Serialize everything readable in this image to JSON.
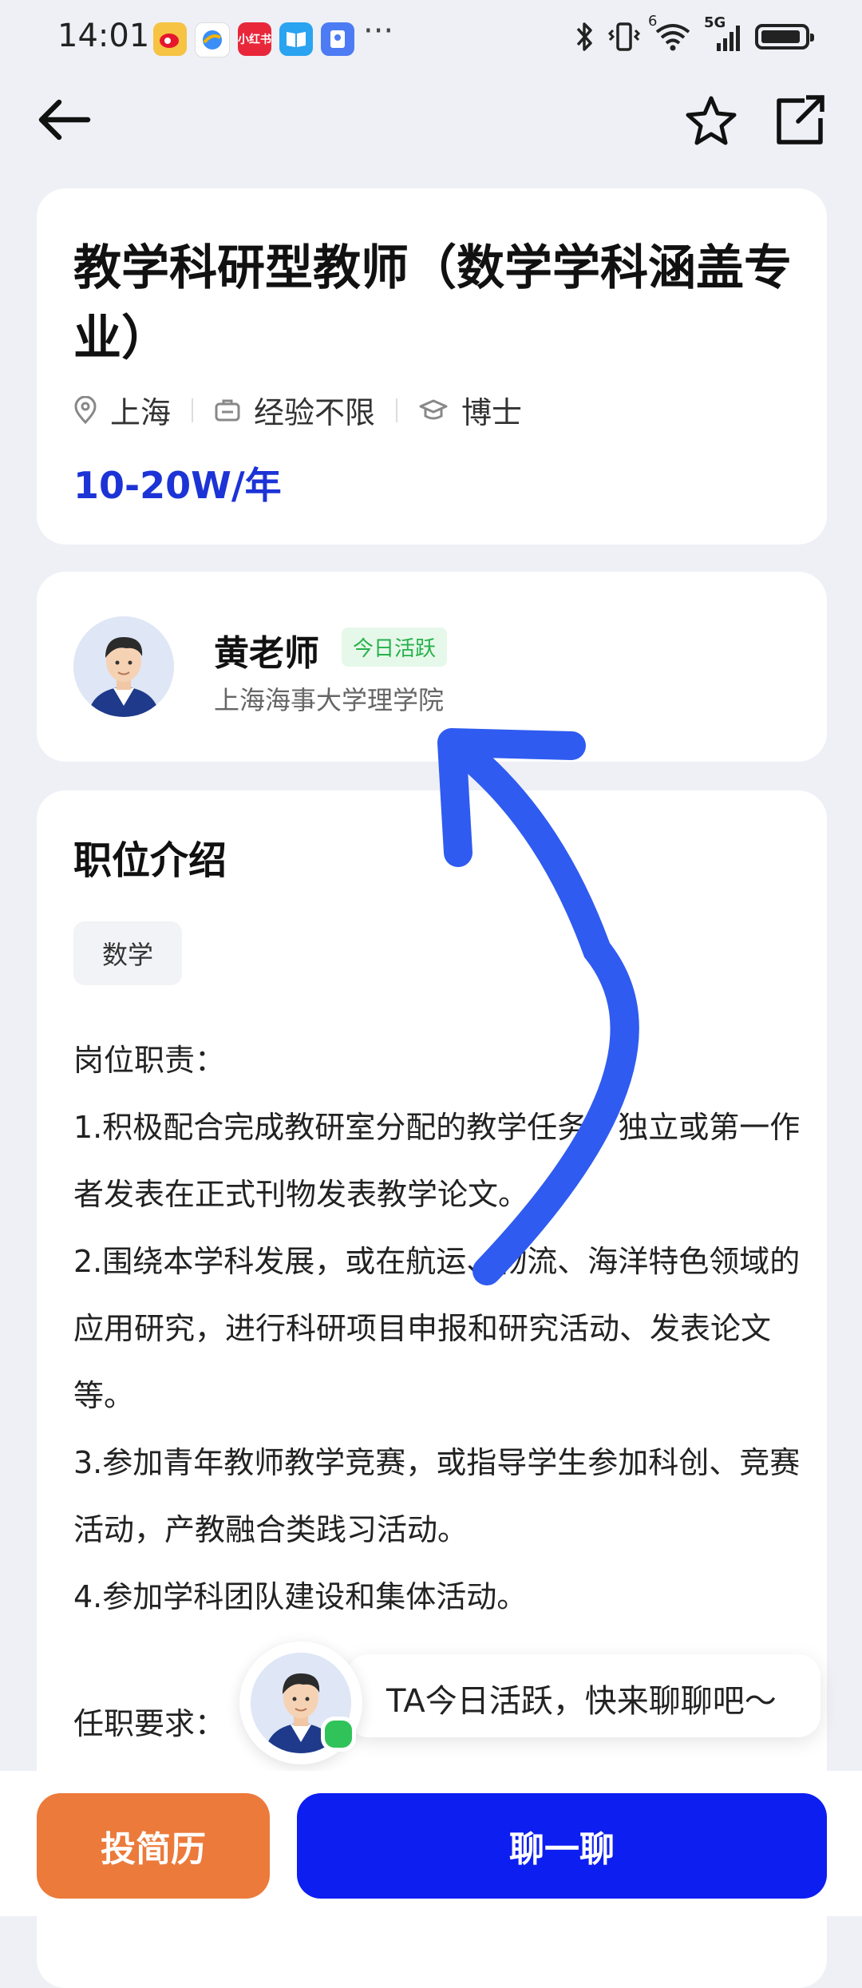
{
  "status_bar": {
    "time": "14:01",
    "app_icons": [
      "weibo-icon",
      "browser-icon",
      "xiaohongshu-icon",
      "book-icon",
      "tool-icon"
    ],
    "xiaohongshu_label": "小红书",
    "more": "···",
    "network": "5G",
    "wifi_badge": "6"
  },
  "job": {
    "title": "教学科研型教师（数学学科涵盖专业）",
    "location": "上海",
    "experience": "经验不限",
    "education": "博士",
    "salary": "10-20W/年"
  },
  "recruiter": {
    "name": "黄老师",
    "badge": "今日活跃",
    "org": "上海海事大学理学院"
  },
  "description": {
    "heading": "职位介绍",
    "tag": "数学",
    "duty_title": "岗位职责：",
    "duties": [
      "1.积极配合完成教研室分配的教学任务；独立或第一作者发表在正式刊物发表教学论文。",
      "2.围绕本学科发展，或在航运、物流、海洋特色领域的应用研究，进行科研项目申报和研究活动、发表论文等。",
      "3.参加青年教师教学竞赛，或指导学生参加科创、竞赛活动，产教融合类践习活动。",
      "4.参加学科团队建设和集体活动。"
    ],
    "requirements_title": "任职要求："
  },
  "chat_prompt": {
    "text": "TA今日活跃，快来聊聊吧～"
  },
  "actions": {
    "resume_label": "投简历",
    "chat_label": "聊一聊"
  },
  "colors": {
    "salary": "#1c33d6",
    "chat_button": "#0d1ef0",
    "resume_button": "#ec7a3a",
    "active_badge": "#27b14a",
    "annotation_arrow": "#2f5bf0"
  }
}
